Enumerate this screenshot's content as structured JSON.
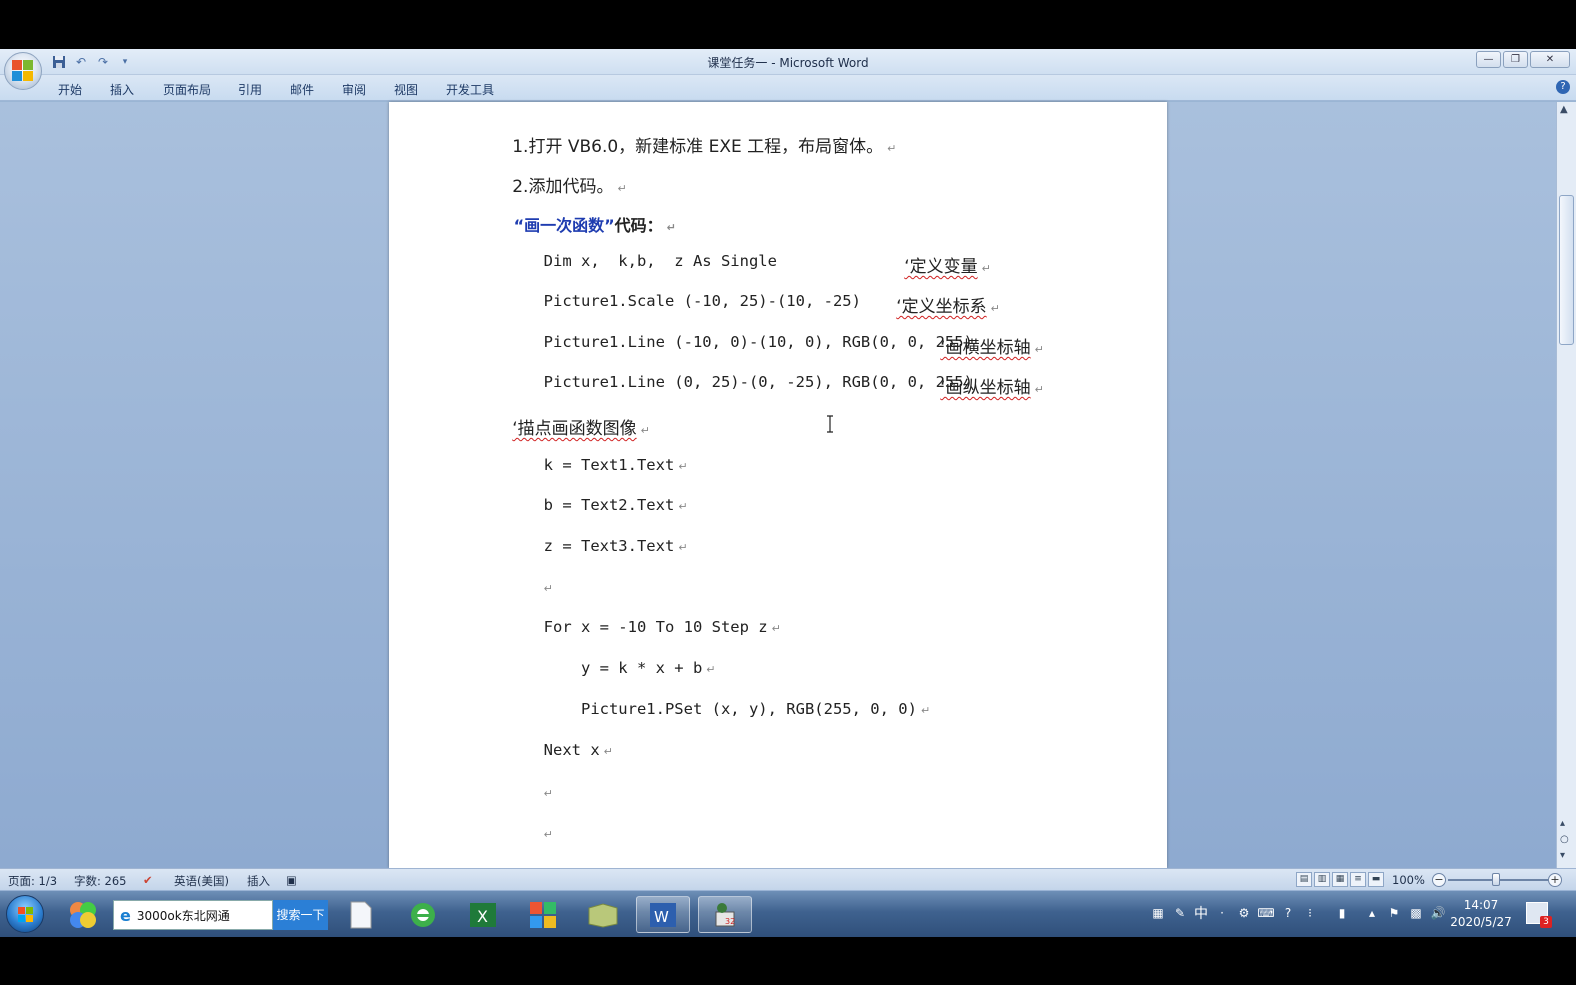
{
  "window": {
    "title": "课堂任务一 - Microsoft Word",
    "controls": [
      "minimize",
      "maximize",
      "close"
    ]
  },
  "ribbon": {
    "tabs": [
      {
        "label": "开始"
      },
      {
        "label": "插入"
      },
      {
        "label": "页面布局"
      },
      {
        "label": "引用"
      },
      {
        "label": "邮件"
      },
      {
        "label": "审阅"
      },
      {
        "label": "视图"
      },
      {
        "label": "开发工具"
      }
    ],
    "help_icon": "?"
  },
  "document": {
    "lines": [
      {
        "text": "1.打开 VB6.0，新建标准 EXE 工程，布局窗体。"
      },
      {
        "text": "2.添加代码。"
      },
      {
        "heading_blue": "“画一次函数”",
        "heading_rest": "代码："
      },
      {
        "code": "Dim x,  k,b,  z As Single",
        "comment": "‘定义变量"
      },
      {
        "code": "Picture1.Scale (-10, 25)-(10, -25)",
        "comment": "‘定义坐标系"
      },
      {
        "code": "Picture1.Line (-10, 0)-(10, 0), RGB(0, 0, 255)",
        "comment": "‘画横坐标轴"
      },
      {
        "code": "Picture1.Line (0, 25)-(0, -25), RGB(0, 0, 255)",
        "comment": "‘画纵坐标轴"
      },
      {
        "text": "‘描点画函数图像"
      },
      {
        "code": "k = Text1.Text"
      },
      {
        "code": "b = Text2.Text"
      },
      {
        "code": "z = Text3.Text"
      },
      {
        "code": ""
      },
      {
        "code": "For x = -10 To 10 Step z"
      },
      {
        "code": "    y = k * x + b"
      },
      {
        "code": "    Picture1.PSet (x, y), RGB(255, 0, 0)"
      },
      {
        "code": "Next x"
      },
      {
        "code": ""
      },
      {
        "code": ""
      },
      {
        "code": ""
      }
    ],
    "paragraph_mark": "↵"
  },
  "statusbar": {
    "page": "页面: 1/3",
    "words": "字数: 265",
    "language": "英语(美国)",
    "mode": "插入",
    "zoom": "100%",
    "zoom_minus": "−",
    "zoom_plus": "+"
  },
  "taskbar": {
    "ie_text": "3000ok东北网通",
    "search_btn": "搜索一下",
    "tray_ime": "中",
    "clock_time": "14:07",
    "clock_date": "2020/5/27",
    "notif_count": "3"
  },
  "colors": {
    "heading_blue": "#1e3cb0",
    "spell_red": "#d02020",
    "grammar_green": "#2a9a2a"
  }
}
